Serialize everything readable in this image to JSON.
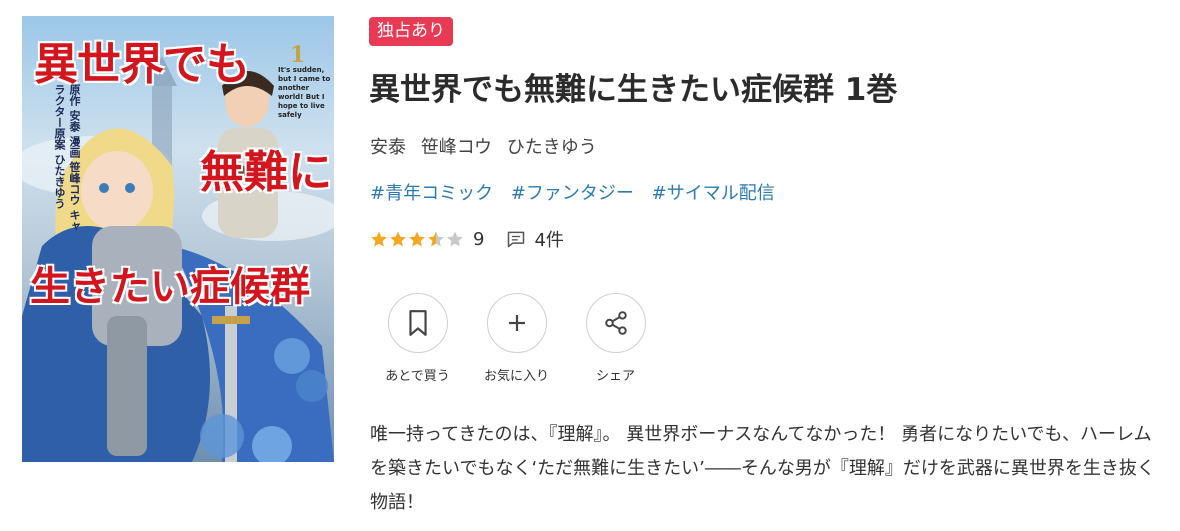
{
  "cover": {
    "title_line1": "異世界でも",
    "title_line2": "無難に",
    "title_line3": "生きたい症候群",
    "volume": "1",
    "english_tagline": "It's sudden, but I came to another world! But I hope to live safely",
    "credits": "原作 安泰 漫画 笹峰コウ キャラクター原案 ひたきゆう"
  },
  "badge": "独占あり",
  "title": "異世界でも無難に生きたい症候群 1巻",
  "authors": [
    "安泰",
    "笹峰コウ",
    "ひたきゆう"
  ],
  "tags": [
    "#青年コミック",
    "#ファンタジー",
    "#サイマル配信"
  ],
  "rating": {
    "stars": 3.5,
    "max": 5,
    "count": "9",
    "reviews": "4件"
  },
  "actions": [
    {
      "label": "あとで買う",
      "icon": "bookmark-icon"
    },
    {
      "label": "お気に入り",
      "icon": "plus-icon"
    },
    {
      "label": "シェア",
      "icon": "share-icon"
    }
  ],
  "description": "唯一持ってきたのは、『理解』。 異世界ボーナスなんてなかった！ 勇者になりたいでも、ハーレムを築きたいでもなく‘ただ無難に生きたい’――そんな男が『理解』だけを武器に異世界を生き抜く物語！",
  "colors": {
    "badge": "#e83a55",
    "tag": "#2c7bb0",
    "star": "#f5a623",
    "star_empty": "#c8c8c8"
  }
}
